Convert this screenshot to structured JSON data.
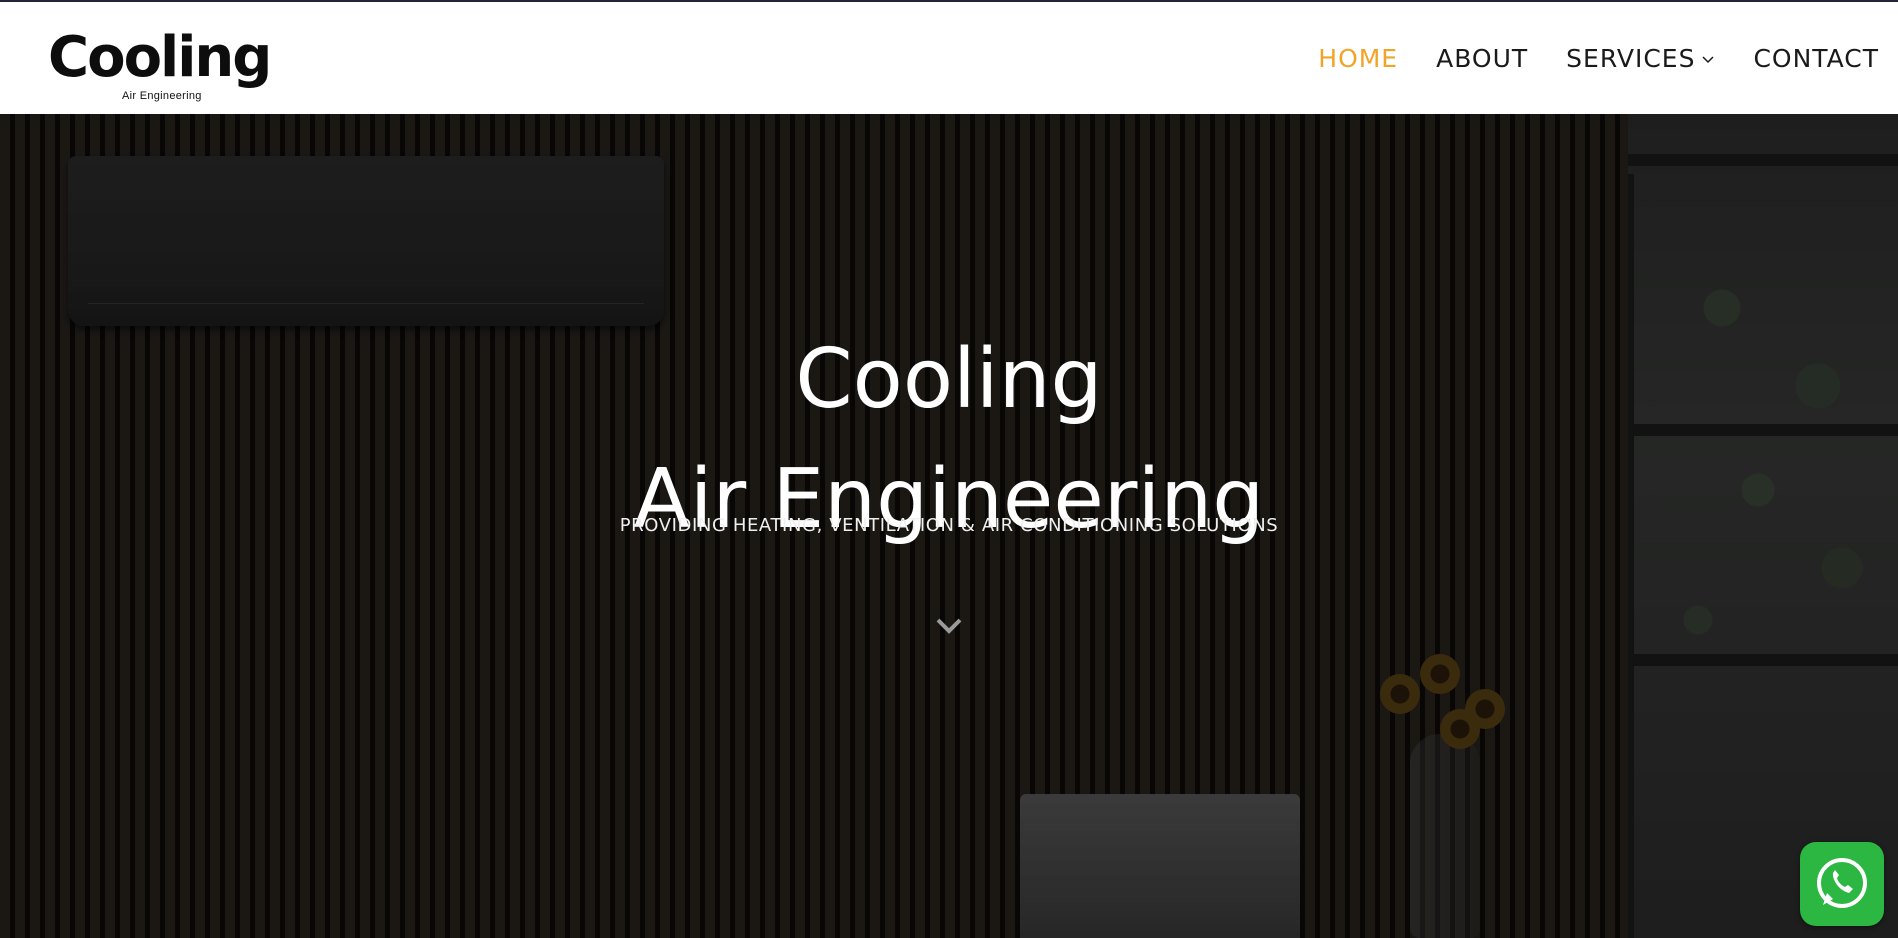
{
  "header": {
    "logo": {
      "wordmark": "Cooling",
      "tagline": "Air Engineering"
    },
    "nav": [
      {
        "label": "HOME",
        "active": true
      },
      {
        "label": "ABOUT",
        "active": false
      },
      {
        "label": "SERVICES",
        "active": false,
        "has_dropdown": true
      },
      {
        "label": "CONTACT",
        "active": false
      }
    ],
    "active_color": "#f0a528"
  },
  "hero": {
    "title_line1": "Cooling",
    "title_line2": "Air Engineering",
    "subtitle": "PROVIDING HEATING, VENTILATION & AIR CONDITIONING SOLUTIONS",
    "scroll_icon": "chevron-down-icon"
  },
  "floating": {
    "whatsapp_icon": "whatsapp-icon",
    "whatsapp_color": "#2bb741"
  }
}
